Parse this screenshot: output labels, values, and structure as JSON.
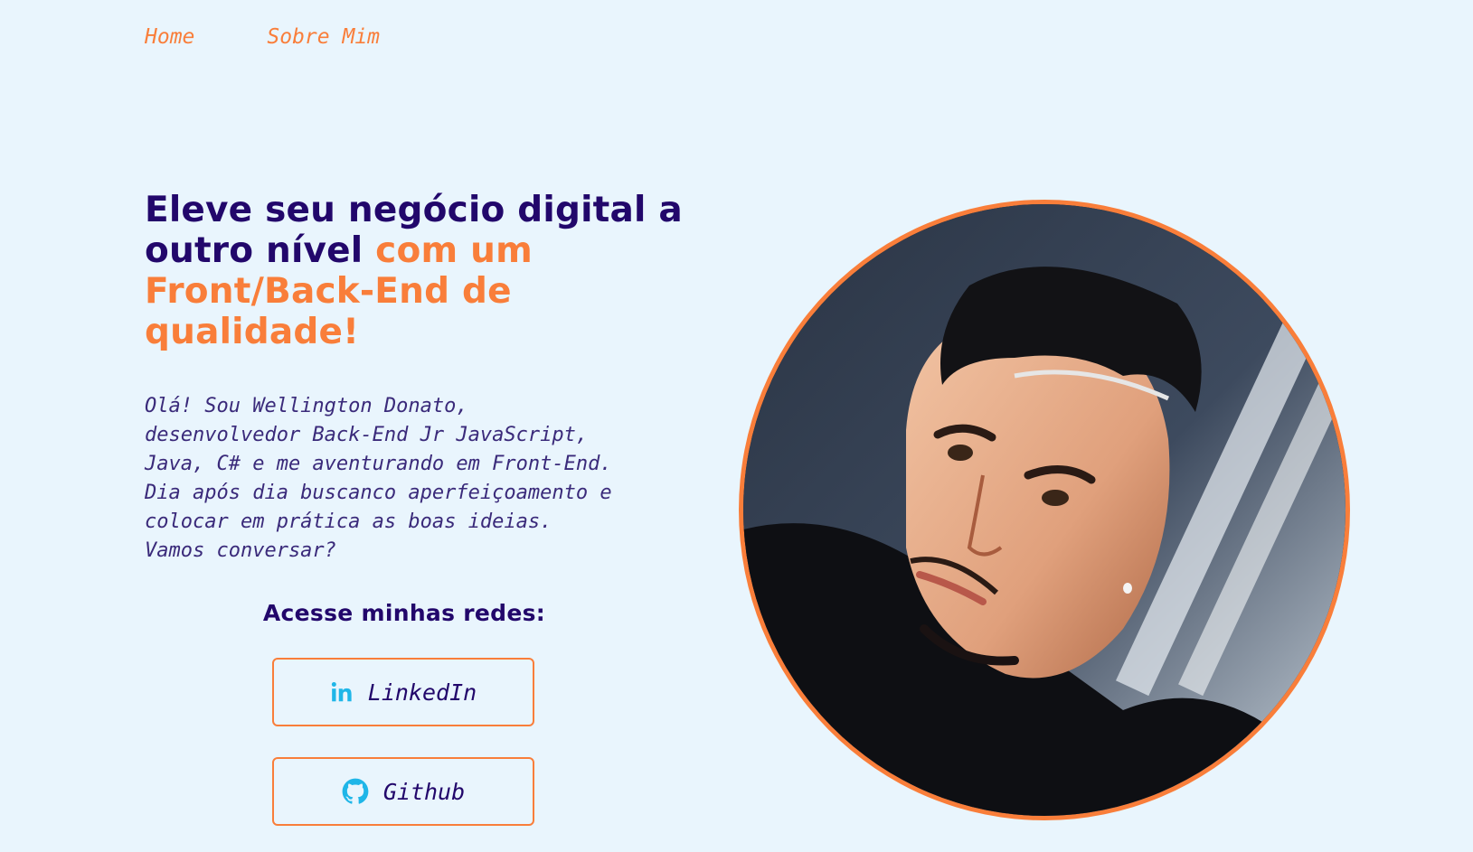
{
  "nav": {
    "items": [
      {
        "label": "Home"
      },
      {
        "label": "Sobre Mim"
      }
    ]
  },
  "hero": {
    "title_main": "Eleve seu negócio digital a outro nível",
    "title_accent": "com um Front/Back-End de qualidade!",
    "intro_lines": [
      "Olá! Sou Wellington Donato,",
      "desenvolvedor Back-End Jr JavaScript,",
      "Java, C# e me aventurando em Front-End.",
      "Dia após dia buscanco aperfeiçoamento e",
      "colocar em prática as boas ideias.",
      "Vamos conversar?"
    ]
  },
  "social": {
    "title": "Acesse minhas redes:",
    "buttons": [
      {
        "label": "LinkedIn",
        "icon": "linkedin-icon"
      },
      {
        "label": "Github",
        "icon": "github-icon"
      }
    ]
  },
  "colors": {
    "background": "#e9f5fd",
    "primary": "#22076b",
    "accent": "#f97e3a",
    "icon": "#1fb6e8"
  }
}
